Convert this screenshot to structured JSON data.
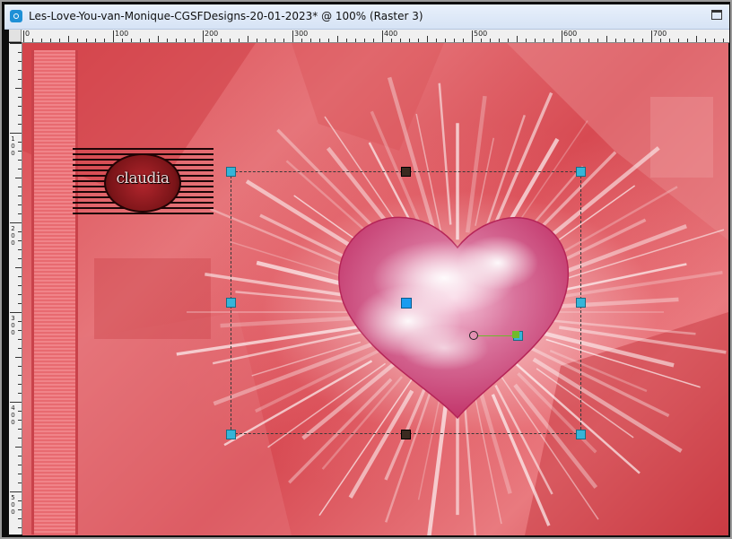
{
  "window": {
    "title": "Les-Love-You-van-Monique-CGSFDesigns-20-01-2023* @ 100% (Raster 3)",
    "app_icon": "camera-icon",
    "maximize_icon": "maximize-icon"
  },
  "rulers": {
    "horizontal_labels": [
      "0",
      "100",
      "200",
      "300",
      "400",
      "500",
      "600",
      "700"
    ],
    "vertical_labels": [
      "100",
      "200",
      "300",
      "400",
      "500"
    ]
  },
  "canvas": {
    "logo_text": "claudia",
    "colors": {
      "background": "#d9484f",
      "highlight": "#ffffff",
      "heart": "#e2506f",
      "handle": "#35b5d8",
      "rotation_handle": "#6fba2c"
    }
  }
}
